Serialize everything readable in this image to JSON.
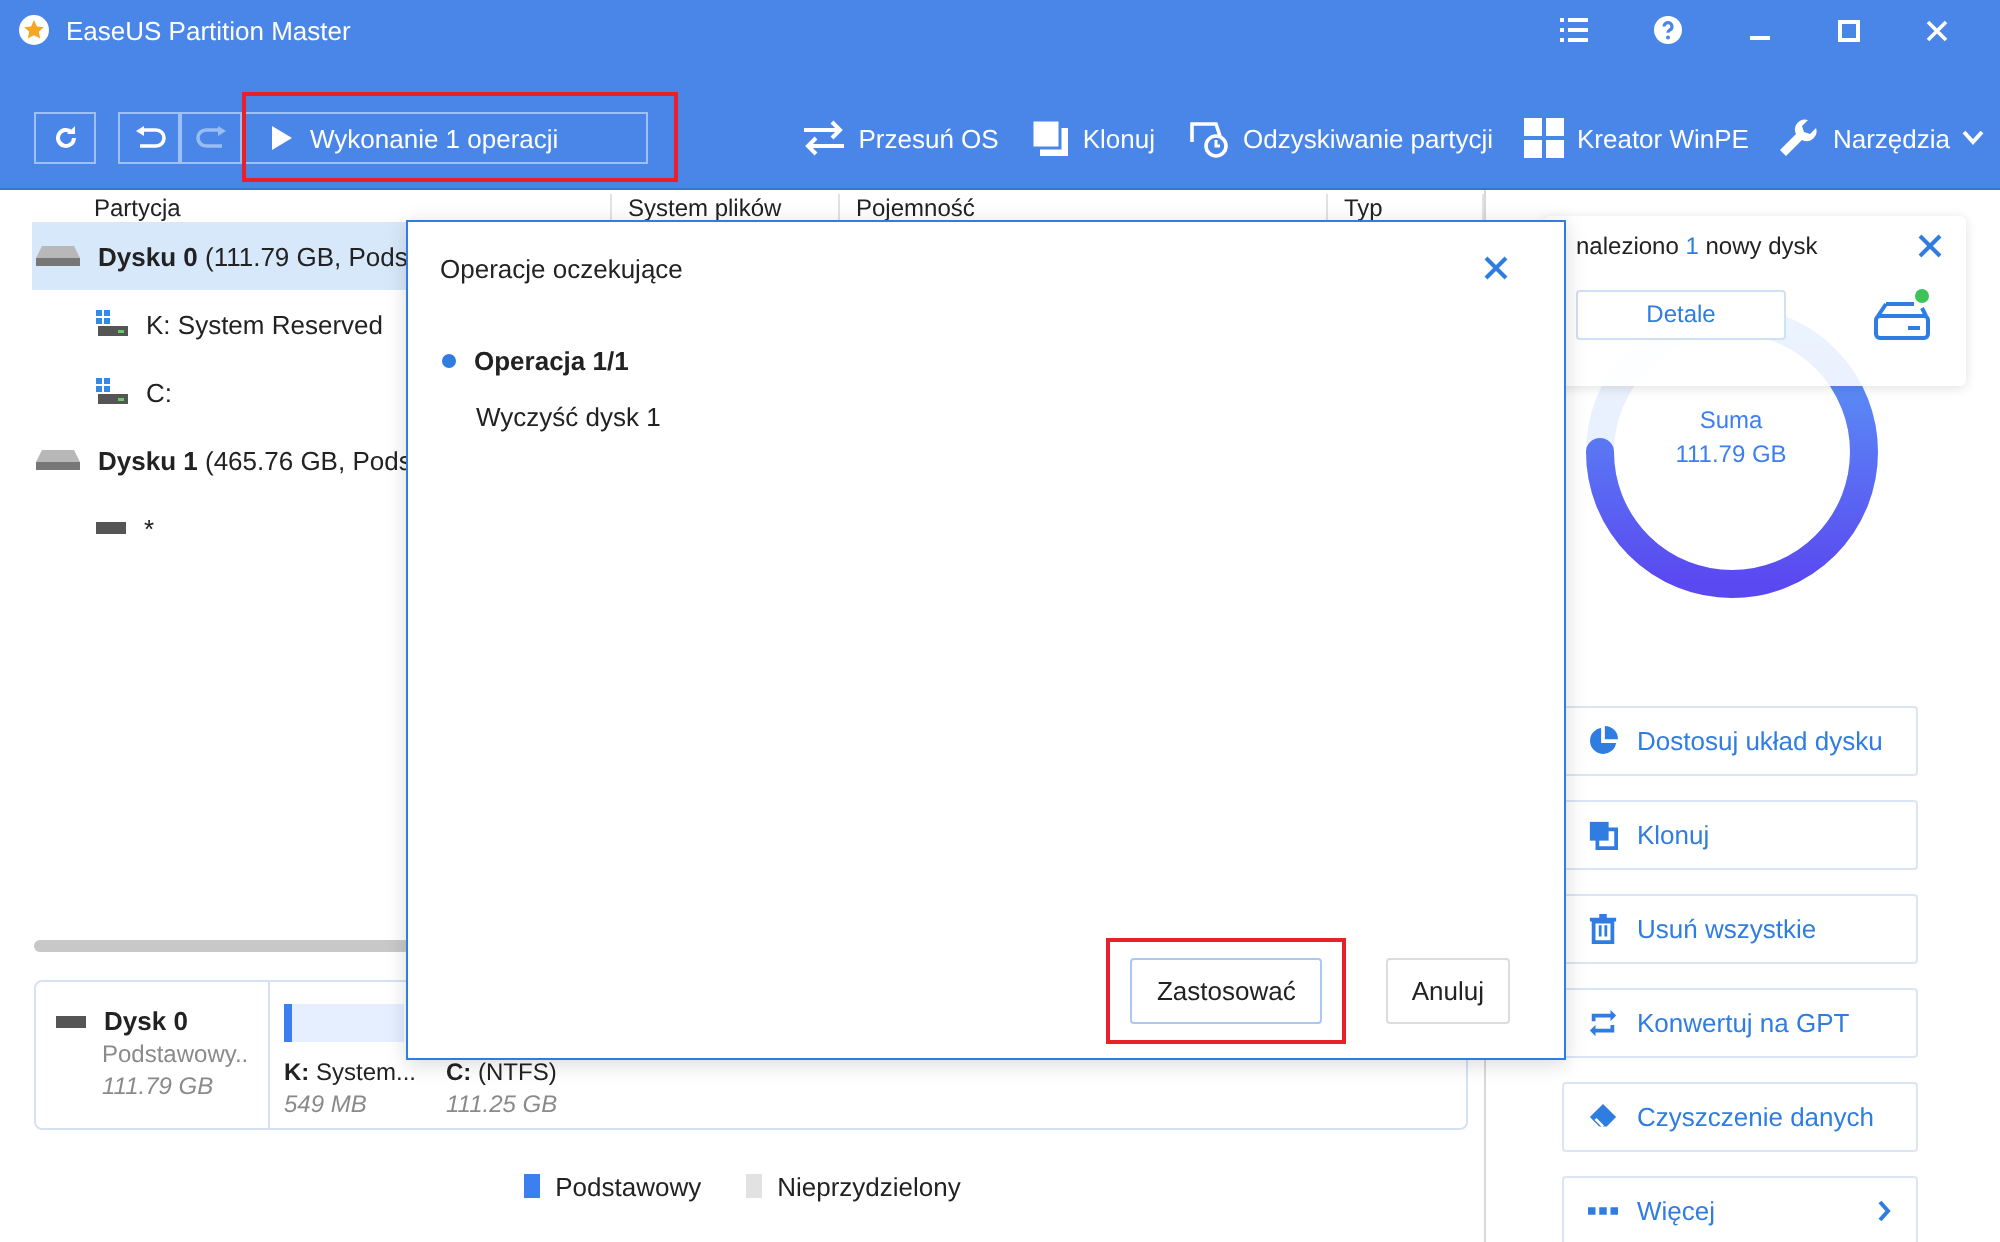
{
  "window": {
    "title": "EaseUS Partition Master"
  },
  "toolbar": {
    "execute": {
      "label": "Wykonanie 1 operacji",
      "highlighted": true
    },
    "items": [
      {
        "kind": "move",
        "label": "Przesuń OS"
      },
      {
        "kind": "clone",
        "label": "Klonuj"
      },
      {
        "kind": "recover",
        "label": "Odzyskiwanie partycji"
      },
      {
        "kind": "winpe",
        "label": "Kreator WinPE"
      },
      {
        "kind": "tools",
        "label": "Narzędzia"
      }
    ]
  },
  "table": {
    "columns": [
      "Partycja",
      "System plików",
      "Pojemność",
      "Typ"
    ],
    "rows": [
      {
        "kind": "disk",
        "name": "Dysku 0",
        "detail": "(111.79 GB, Pods",
        "selected": true
      },
      {
        "kind": "system",
        "name": "K: System Reserved",
        "selected": false
      },
      {
        "kind": "system",
        "name": "C:",
        "selected": false
      },
      {
        "kind": "disk",
        "name": "Dysku 1",
        "detail": "(465.76 GB, Pods",
        "selected": false
      },
      {
        "kind": "drive",
        "name": "*",
        "selected": false
      }
    ]
  },
  "disk_map": {
    "disk": {
      "name": "Dysk 0",
      "type": "Podstawowy..",
      "size": "111.79 GB"
    },
    "partitions": [
      {
        "label": "K:",
        "name": "System...",
        "size": "549 MB"
      },
      {
        "label": "C:",
        "name": "(NTFS)",
        "size": "111.25 GB"
      }
    ]
  },
  "legend": [
    {
      "label": "Podstawowy",
      "color": "#3b7ff0"
    },
    {
      "label": "Nieprzydzielony",
      "color": "#e2e2e2"
    }
  ],
  "summary": {
    "total_label": "Suma",
    "total": "111.79 GB"
  },
  "notification": {
    "prefix": "naleziono",
    "count": "1",
    "suffix": "nowy dysk",
    "button": "Detale"
  },
  "actions": [
    {
      "kind": "layout",
      "label": "Dostosuj układ dysku"
    },
    {
      "kind": "clone",
      "label": "Klonuj"
    },
    {
      "kind": "delete",
      "label": "Usuń wszystkie"
    },
    {
      "kind": "convert",
      "label": "Konwertuj na GPT"
    },
    {
      "kind": "wipe",
      "label": "Czyszczenie danych"
    },
    {
      "kind": "more",
      "label": "Więcej"
    }
  ],
  "dialog": {
    "title": "Operacje oczekujące",
    "operations": [
      {
        "title": "Operacja 1/1",
        "description": "Wyczyść dysk 1"
      }
    ],
    "buttons": [
      {
        "label": "Zastosować",
        "highlighted": true
      },
      {
        "label": "Anuluj",
        "highlighted": false
      }
    ]
  }
}
